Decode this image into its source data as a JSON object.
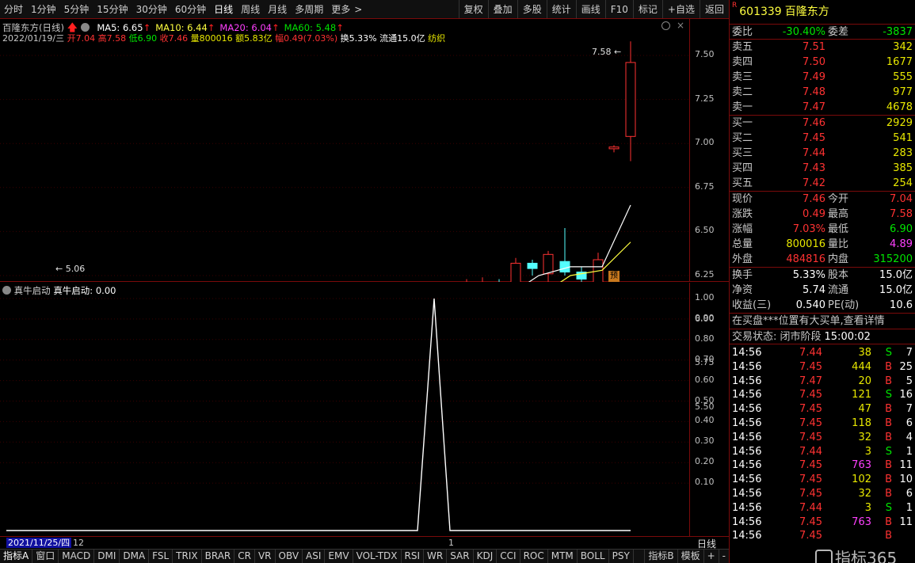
{
  "toolbar": {
    "periods": [
      "分时",
      "1分钟",
      "5分钟",
      "15分钟",
      "30分钟",
      "60分钟",
      "日线",
      "周线",
      "月线",
      "多周期",
      "更多"
    ],
    "active_period": "日线",
    "more_chevron": ">",
    "right_buttons": [
      "复权",
      "叠加",
      "多股",
      "统计",
      "画线",
      "F10",
      "标记",
      "+自选",
      "返回"
    ]
  },
  "chart": {
    "name": "百隆东方(日线)",
    "ma": [
      {
        "label": "MA5: 6.65",
        "color": "#ffffff"
      },
      {
        "label": "MA10: 6.44",
        "color": "#ffff40"
      },
      {
        "label": "MA20: 6.04",
        "color": "#ff40ff"
      },
      {
        "label": "MA60: 5.48",
        "color": "#00e000"
      }
    ],
    "info": {
      "date": "2022/01/19/三",
      "open": "开7.04",
      "high": "高7.58",
      "low": "低6.90",
      "close": "收7.46",
      "volume": "量800016",
      "amount": "额5.83亿",
      "change": "幅0.49(7.03%)",
      "turnover": "换5.33%",
      "float": "流通15.0亿",
      "industry": "纺织"
    },
    "max_label": "7.58",
    "min_label": "5.06",
    "pre_badge": "预",
    "y_ticks": [
      "7.50",
      "7.25",
      "7.00",
      "6.75",
      "6.50",
      "6.25",
      "6.00",
      "5.75",
      "5.50"
    ]
  },
  "indicator": {
    "name": "真牛启动",
    "value_label": "真牛启动: 0.00",
    "y_ticks": [
      "1.00",
      "0.90",
      "0.80",
      "0.70",
      "0.60",
      "0.50",
      "0.40",
      "0.30",
      "0.20",
      "0.10"
    ]
  },
  "date_bar": {
    "start": "2021/11/25/四",
    "month1": "12",
    "month2": "1",
    "period_label": "日线"
  },
  "bottom_tabs": [
    "指标A",
    "窗口",
    "MACD",
    "DMI",
    "DMA",
    "FSL",
    "TRIX",
    "BRAR",
    "CR",
    "VR",
    "OBV",
    "ASI",
    "EMV",
    "VOL-TDX",
    "RSI",
    "WR",
    "SAR",
    "KDJ",
    "CCI",
    "ROC",
    "MTM",
    "BOLL",
    "PSY"
  ],
  "bottom_right": [
    "指标B",
    "模板",
    "+",
    "-"
  ],
  "stock": {
    "badge": "R",
    "code": "601339",
    "name": "百隆东方"
  },
  "order_book": {
    "ratio": {
      "label": "委比",
      "value": "-30.40%",
      "diff_label": "委差",
      "diff": "-3837"
    },
    "asks": [
      {
        "label": "卖五",
        "price": "7.51",
        "vol": "342"
      },
      {
        "label": "卖四",
        "price": "7.50",
        "vol": "1677"
      },
      {
        "label": "卖三",
        "price": "7.49",
        "vol": "555"
      },
      {
        "label": "卖二",
        "price": "7.48",
        "vol": "977"
      },
      {
        "label": "卖一",
        "price": "7.47",
        "vol": "4678"
      }
    ],
    "bids": [
      {
        "label": "买一",
        "price": "7.46",
        "vol": "2929"
      },
      {
        "label": "买二",
        "price": "7.45",
        "vol": "541"
      },
      {
        "label": "买三",
        "price": "7.44",
        "vol": "283"
      },
      {
        "label": "买四",
        "price": "7.43",
        "vol": "385"
      },
      {
        "label": "买五",
        "price": "7.42",
        "vol": "254"
      }
    ]
  },
  "quote": [
    {
      "l1": "现价",
      "v1": "7.46",
      "l2": "今开",
      "v2": "7.04"
    },
    {
      "l1": "涨跌",
      "v1": "0.49",
      "l2": "最高",
      "v2": "7.58"
    },
    {
      "l1": "涨幅",
      "v1": "7.03%",
      "l2": "最低",
      "v2": "6.90"
    },
    {
      "l1": "总量",
      "v1": "800016",
      "l2": "量比",
      "v2": "4.89"
    },
    {
      "l1": "外盘",
      "v1": "484816",
      "l2": "内盘",
      "v2": "315200"
    }
  ],
  "fund": [
    {
      "l1": "换手",
      "v1": "5.33%",
      "l2": "股本",
      "v2": "15.0亿"
    },
    {
      "l1": "净资",
      "v1": "5.74",
      "l2": "流通",
      "v2": "15.0亿"
    },
    {
      "l1": "收益(三)",
      "v1": "0.540",
      "l2": "PE(动)",
      "v2": "10.6"
    }
  ],
  "notice": "在买盘***位置有大买单,查看详情",
  "status": {
    "label": "交易状态: 闭市阶段",
    "time": "15:00:02"
  },
  "ticks": [
    {
      "t": "14:56",
      "p": "7.44",
      "v": "38",
      "s": "S",
      "n": "7"
    },
    {
      "t": "14:56",
      "p": "7.45",
      "v": "444",
      "s": "B",
      "n": "25"
    },
    {
      "t": "14:56",
      "p": "7.47",
      "v": "20",
      "s": "B",
      "n": "5"
    },
    {
      "t": "14:56",
      "p": "7.45",
      "v": "121",
      "s": "S",
      "n": "16"
    },
    {
      "t": "14:56",
      "p": "7.45",
      "v": "47",
      "s": "B",
      "n": "7"
    },
    {
      "t": "14:56",
      "p": "7.45",
      "v": "118",
      "s": "B",
      "n": "6"
    },
    {
      "t": "14:56",
      "p": "7.45",
      "v": "32",
      "s": "B",
      "n": "4"
    },
    {
      "t": "14:56",
      "p": "7.44",
      "v": "3",
      "s": "S",
      "n": "1"
    },
    {
      "t": "14:56",
      "p": "7.45",
      "v": "763",
      "s": "B",
      "n": "11"
    },
    {
      "t": "14:56",
      "p": "7.45",
      "v": "102",
      "s": "B",
      "n": "10"
    },
    {
      "t": "14:56",
      "p": "7.45",
      "v": "32",
      "s": "B",
      "n": "6"
    },
    {
      "t": "14:56",
      "p": "7.44",
      "v": "3",
      "s": "S",
      "n": "1"
    },
    {
      "t": "14:56",
      "p": "7.45",
      "v": "763",
      "s": "B",
      "n": "11"
    },
    {
      "t": "14:56",
      "p": "7.45",
      "v": "",
      "s": "B",
      "n": ""
    }
  ],
  "watermark": "指标365"
}
